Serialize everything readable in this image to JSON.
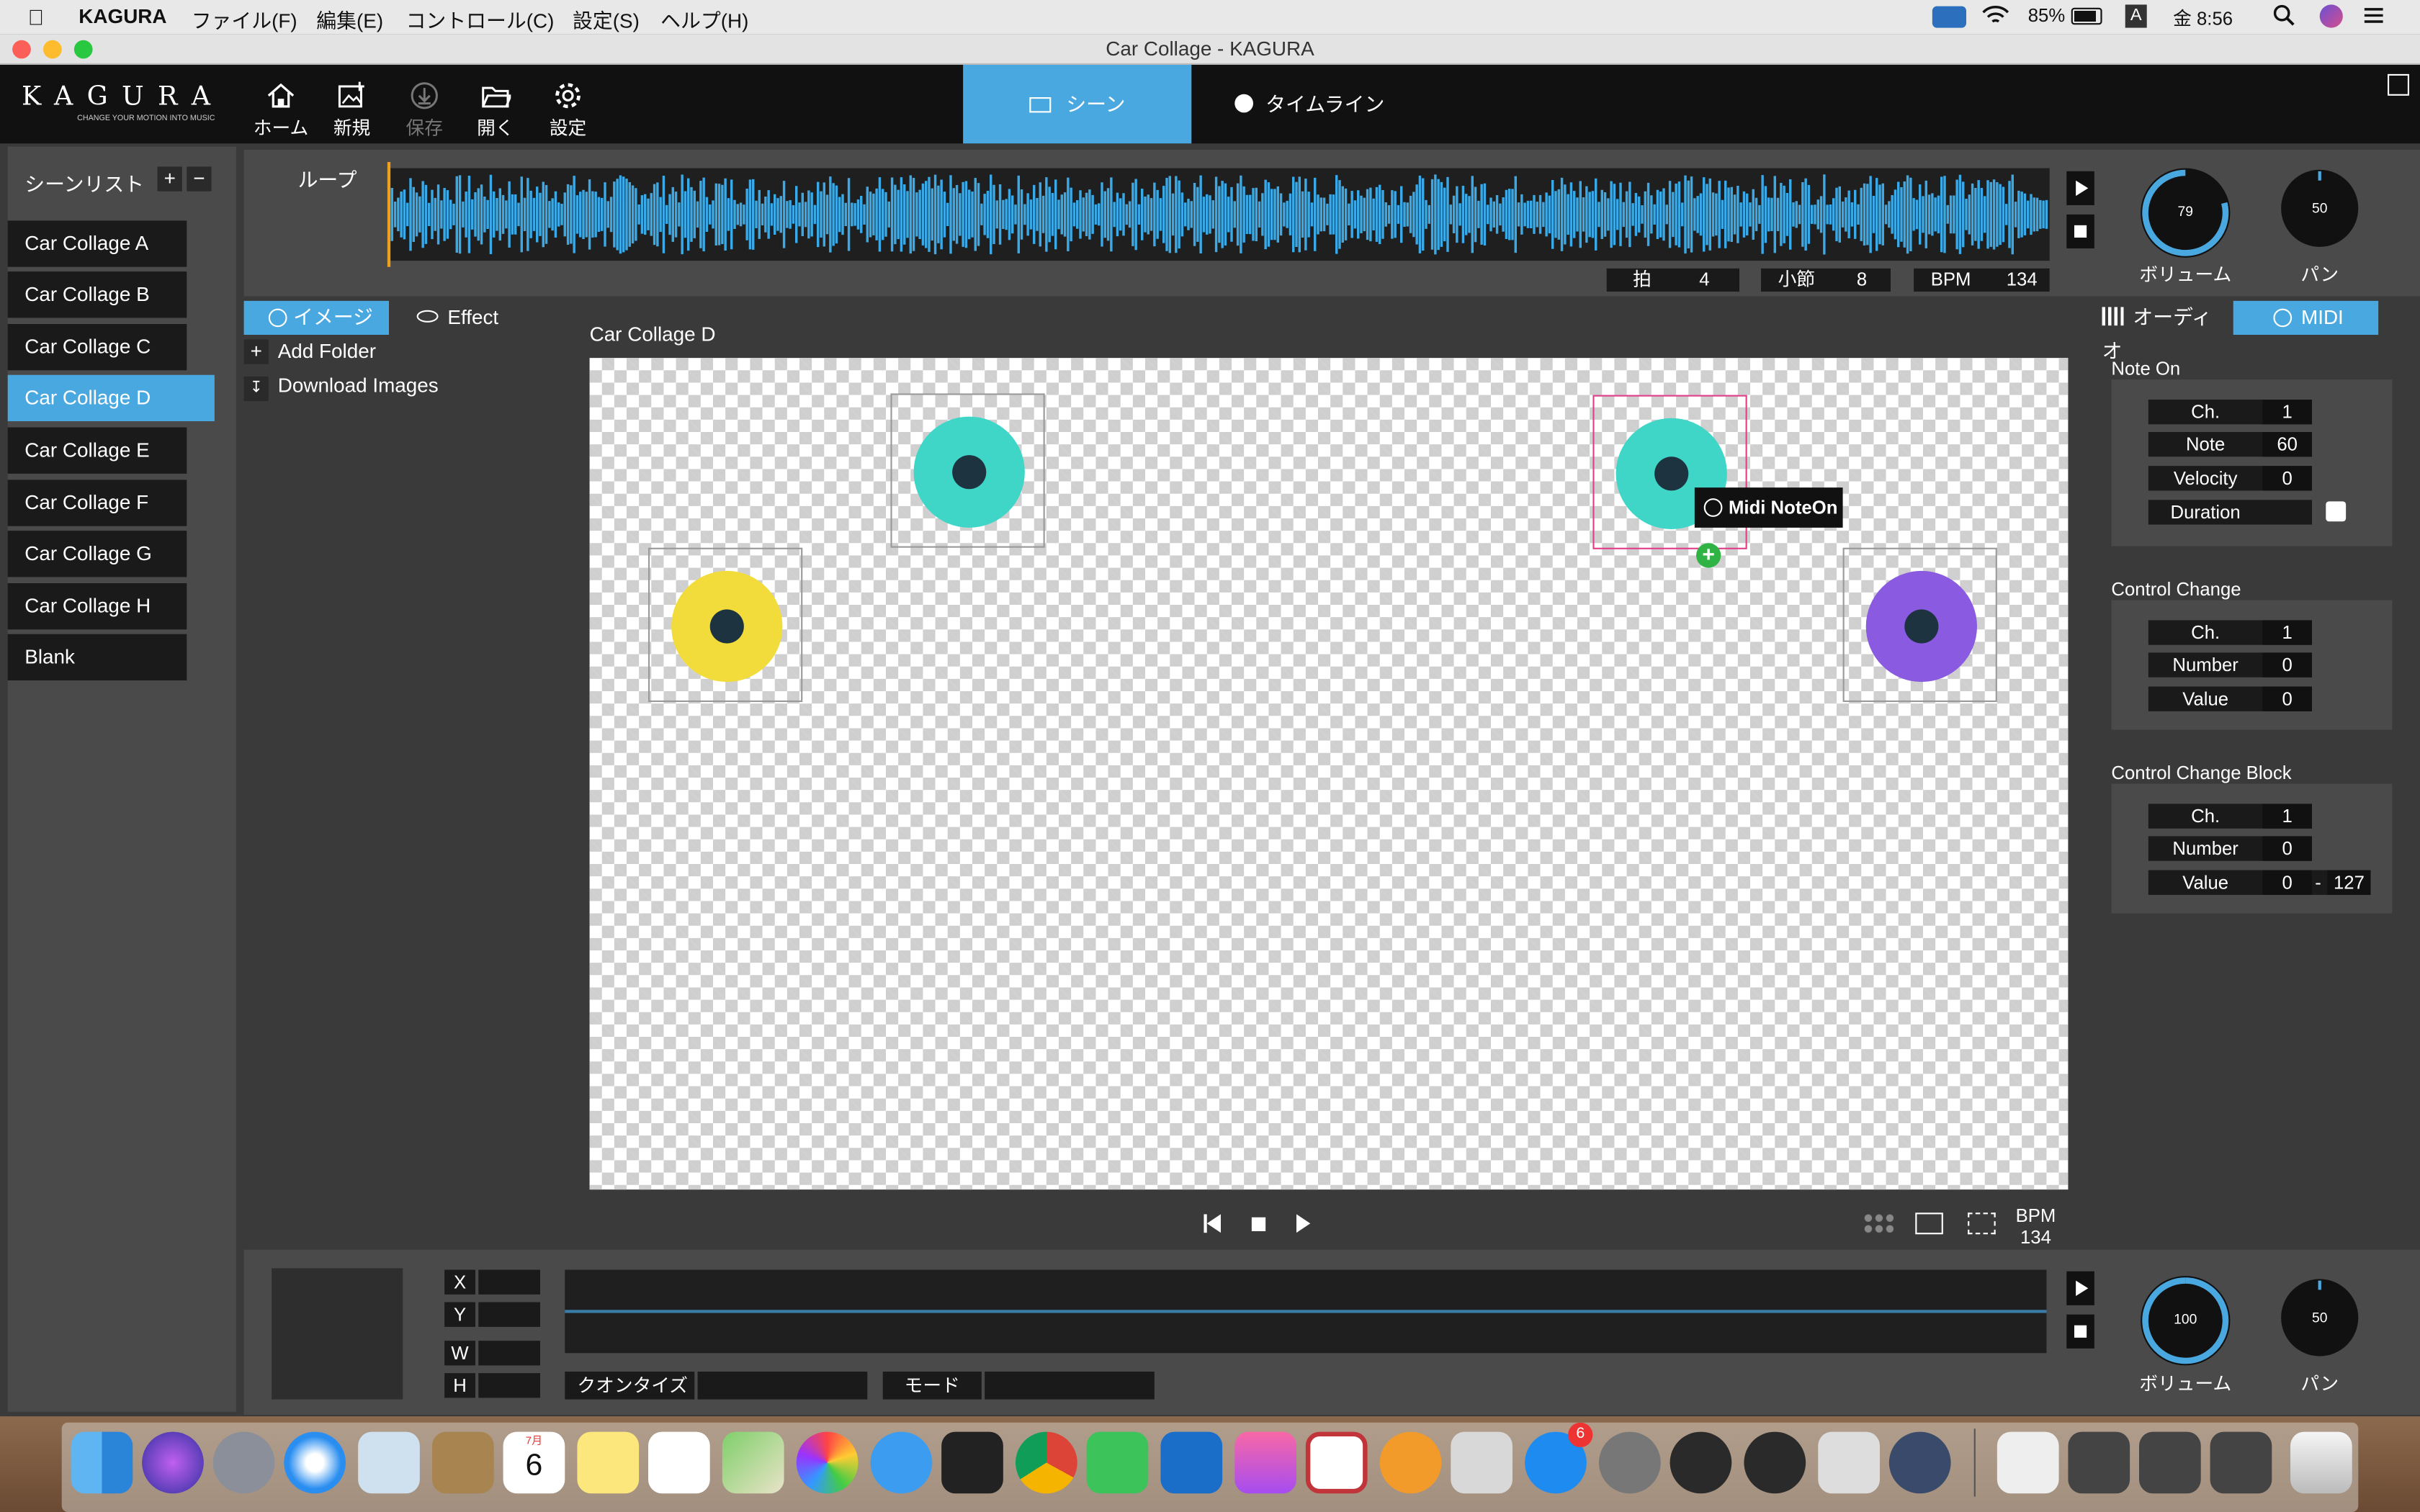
{
  "menubar": {
    "app": "KAGURA",
    "items": [
      "ファイル(F)",
      "編集(E)",
      "コントロール(C)",
      "設定(S)",
      "ヘルプ(H)"
    ],
    "battery": "85%",
    "input": "A",
    "clock": "金 8:56"
  },
  "window": {
    "title": "Car Collage - KAGURA"
  },
  "toolbar": {
    "logo": "KAGURA",
    "logo_tag": "CHANGE YOUR MOTION INTO MUSIC",
    "home": "ホーム",
    "new": "新規",
    "save": "保存",
    "open": "開く",
    "settings": "設定",
    "tab_scene": "シーン",
    "tab_timeline": "タイムライン"
  },
  "scenes": {
    "title": "シーンリスト",
    "add": "+",
    "remove": "−",
    "items": [
      "Car Collage A",
      "Car Collage B",
      "Car Collage C",
      "Car Collage D",
      "Car Collage E",
      "Car Collage F",
      "Car Collage G",
      "Car Collage H",
      "Blank"
    ],
    "selected": "Car Collage D"
  },
  "audio": {
    "loop_label": "ループ",
    "beat_label": "拍",
    "beat": "4",
    "bar_label": "小節",
    "bar": "8",
    "bpm_label": "BPM",
    "bpm": "134",
    "volume": "79",
    "volume_label": "ボリューム",
    "pan": "50",
    "pan_label": "パン",
    "volume_level": 0.79,
    "pan_level": 0.5
  },
  "assets": {
    "tab_image": "イメージ",
    "tab_effect": "Effect",
    "add_folder": "Add Folder",
    "download": "Download Images"
  },
  "canvas": {
    "title": "Car Collage D",
    "tooltip": "Midi NoteOn"
  },
  "colors": {
    "accent": "#4aa8e0",
    "teal": "#3fd6c8",
    "yellow": "#f2dc3c",
    "purple": "#8a5ae0",
    "selection": "#e0408a"
  },
  "right": {
    "tab_audio": "オーディオ",
    "tab_midi": "MIDI",
    "note_on": {
      "title": "Note On",
      "ch_label": "Ch.",
      "ch": "1",
      "note_label": "Note",
      "note": "60",
      "velocity_label": "Velocity",
      "velocity": "0",
      "duration_label": "Duration"
    },
    "cc": {
      "title": "Control Change",
      "ch_label": "Ch.",
      "ch": "1",
      "number_label": "Number",
      "number": "0",
      "value_label": "Value",
      "value": "0"
    },
    "ccb": {
      "title": "Control Change Block",
      "ch_label": "Ch.",
      "ch": "1",
      "number_label": "Number",
      "number": "0",
      "value_label": "Value",
      "value_min": "0",
      "sep": "-",
      "value_max": "127"
    }
  },
  "transport": {
    "bpm_label": "BPM",
    "bpm": "134"
  },
  "bottom": {
    "x": "X",
    "y": "Y",
    "w": "W",
    "h": "H",
    "quantize": "クオンタイズ",
    "mode": "モード",
    "volume": "100",
    "volume_label": "ボリューム",
    "pan": "50",
    "pan_label": "パン",
    "volume_level": 1.0,
    "pan_level": 0.5
  },
  "dock": {
    "calendar_month": "7月",
    "calendar_day": "6",
    "appstore_badge": "6"
  }
}
